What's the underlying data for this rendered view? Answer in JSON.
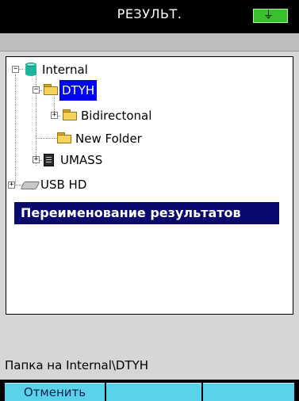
{
  "titlebar": {
    "title": "РЕЗУЛЬТ.",
    "battery_icon": "battery-plug-icon",
    "battery_color": "#39c12d"
  },
  "tree": {
    "items": [
      {
        "label": "Internal",
        "icon": "database-icon",
        "expander": "−"
      },
      {
        "label": "DTYH",
        "icon": "folder-icon",
        "expander": "−",
        "selected": true
      },
      {
        "label": "Bidirectonal",
        "icon": "folder-icon",
        "expander": "+"
      },
      {
        "label": "New Folder",
        "icon": "folder-icon"
      },
      {
        "label": "UMASS",
        "icon": "usb-storage-icon",
        "expander": "+"
      },
      {
        "label": "USB HD",
        "icon": "hard-drive-icon",
        "expander": "+"
      }
    ]
  },
  "banner": {
    "text": "Переименование результатов"
  },
  "status": {
    "text": "Папка на Internal\\DTYH"
  },
  "softkeys": {
    "cancel_label": "Отменить",
    "key2_label": "",
    "key3_label": "",
    "color": "#5ad2e9"
  },
  "colors": {
    "selection": "#0000ff",
    "banner": "#0a0a6e"
  }
}
